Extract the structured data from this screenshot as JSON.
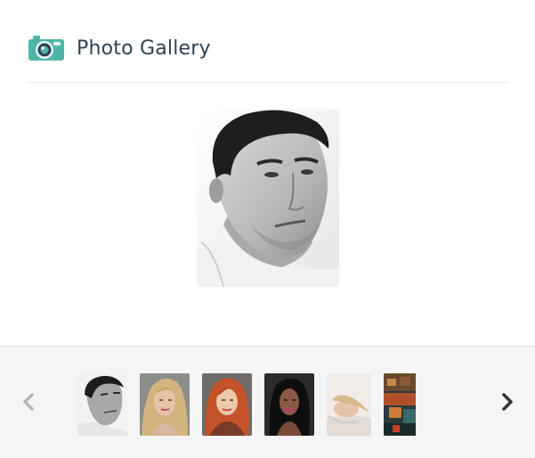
{
  "header": {
    "title": "Photo Gallery",
    "icon": "camera-icon"
  },
  "main_photo": {
    "subject": "man-portrait-bw",
    "index": 1
  },
  "strip": {
    "prev_icon": "chevron-left-icon",
    "next_icon": "chevron-right-icon",
    "thumbnails": [
      {
        "name": "man-portrait-bw"
      },
      {
        "name": "blonde-woman-portrait"
      },
      {
        "name": "redhead-woman-portrait"
      },
      {
        "name": "dark-haired-woman-portrait"
      },
      {
        "name": "woman-lying-white"
      },
      {
        "name": "colorful-partial-image"
      }
    ]
  },
  "colors": {
    "accent": "#4fb5a8",
    "title": "#2f4154",
    "strip_bg": "#f5f5f5",
    "arrow_inactive": "#b5b5b5",
    "arrow_active": "#333333"
  }
}
